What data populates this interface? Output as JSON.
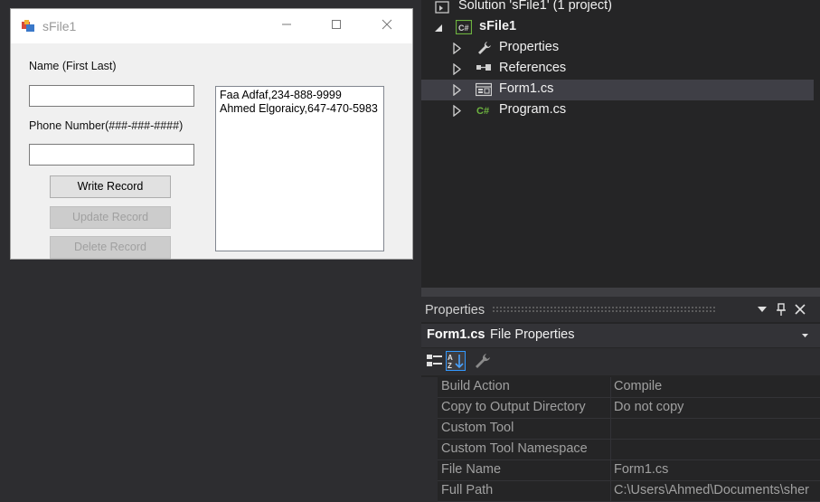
{
  "form": {
    "title": "sFile1",
    "name_label": "Name (First Last)",
    "name_value": "",
    "phone_label": "Phone Number(###-###-####)",
    "phone_value": "",
    "write_button": "Write Record",
    "update_button": "Update Record",
    "delete_button": "Delete Record",
    "records": [
      "Faa Adfaf,234-888-9999",
      "Ahmed Elgoraicy,647-470-5983"
    ]
  },
  "solution_explorer": {
    "solution": "Solution 'sFile1' (1 project)",
    "project": "sFile1",
    "items": [
      {
        "label": "Properties",
        "icon": "wrench-icon"
      },
      {
        "label": "References",
        "icon": "references-icon"
      },
      {
        "label": "Form1.cs",
        "icon": "form-icon",
        "selected": true
      },
      {
        "label": "Program.cs",
        "icon": "csharp-file-icon"
      }
    ]
  },
  "properties": {
    "title": "Properties",
    "object_name": "Form1.cs",
    "object_type": "File Properties",
    "rows": [
      {
        "name": "Build Action",
        "value": "Compile"
      },
      {
        "name": "Copy to Output Directory",
        "value": "Do not copy"
      },
      {
        "name": "Custom Tool",
        "value": ""
      },
      {
        "name": "Custom Tool Namespace",
        "value": ""
      },
      {
        "name": "File Name",
        "value": "Form1.cs"
      },
      {
        "name": "Full Path",
        "value": "C:\\Users\\Ahmed\\Documents\\sher"
      }
    ]
  },
  "colors": {
    "ide_background": "#2d2d30",
    "panel_background": "#252526",
    "selection": "#3f3f46",
    "csharp_green": "#6db33f"
  }
}
